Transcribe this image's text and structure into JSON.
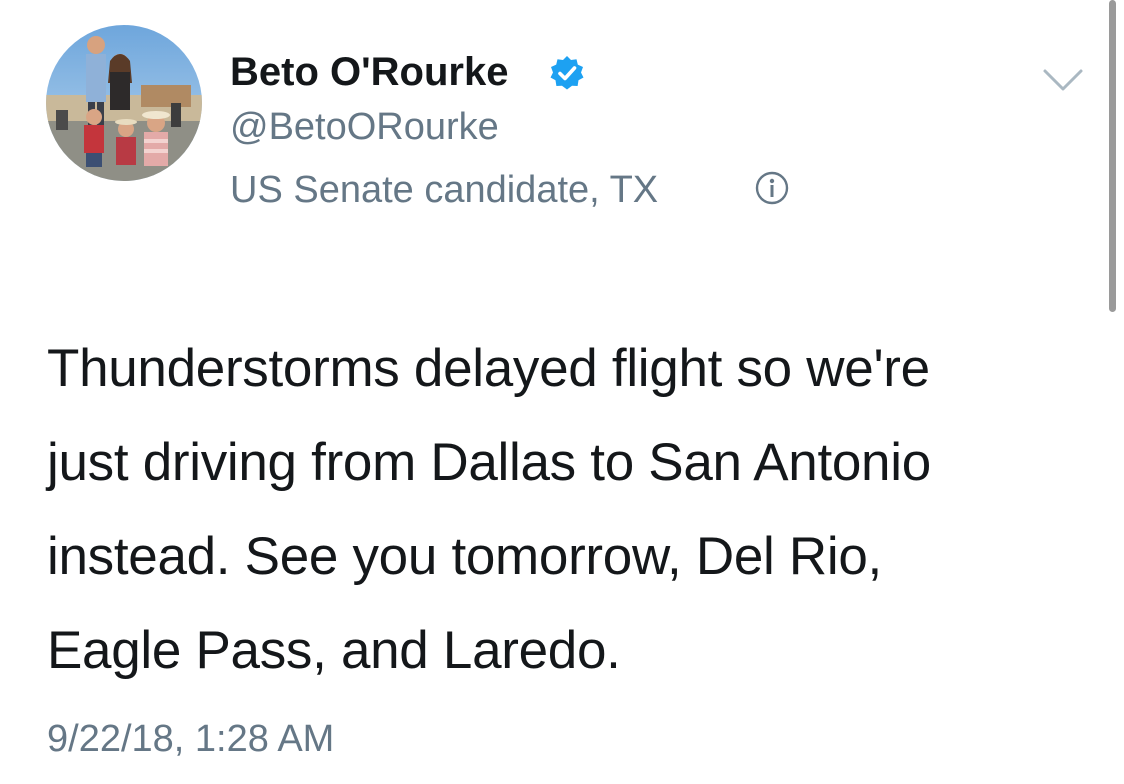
{
  "author": {
    "display_name": "Beto O'Rourke",
    "handle": "@BetoORourke",
    "bio_label": "US Senate candidate, TX",
    "verified": true,
    "avatar_icon": "family-photo-avatar",
    "verified_icon": "verified-badge-icon",
    "info_icon": "info-icon"
  },
  "menu": {
    "icon": "chevron-down-icon"
  },
  "tweet": {
    "lines": [
      "Thunderstorms delayed flight so we're",
      "just driving from Dallas to San Antonio",
      "instead. See you tomorrow, Del Rio,",
      "Eagle Pass, and Laredo."
    ],
    "timestamp": "9/22/18, 1:28 AM"
  },
  "colors": {
    "text_primary": "#14171a",
    "text_secondary": "#657786",
    "verified_blue": "#1da1f2",
    "chevron": "#aab8c2"
  }
}
